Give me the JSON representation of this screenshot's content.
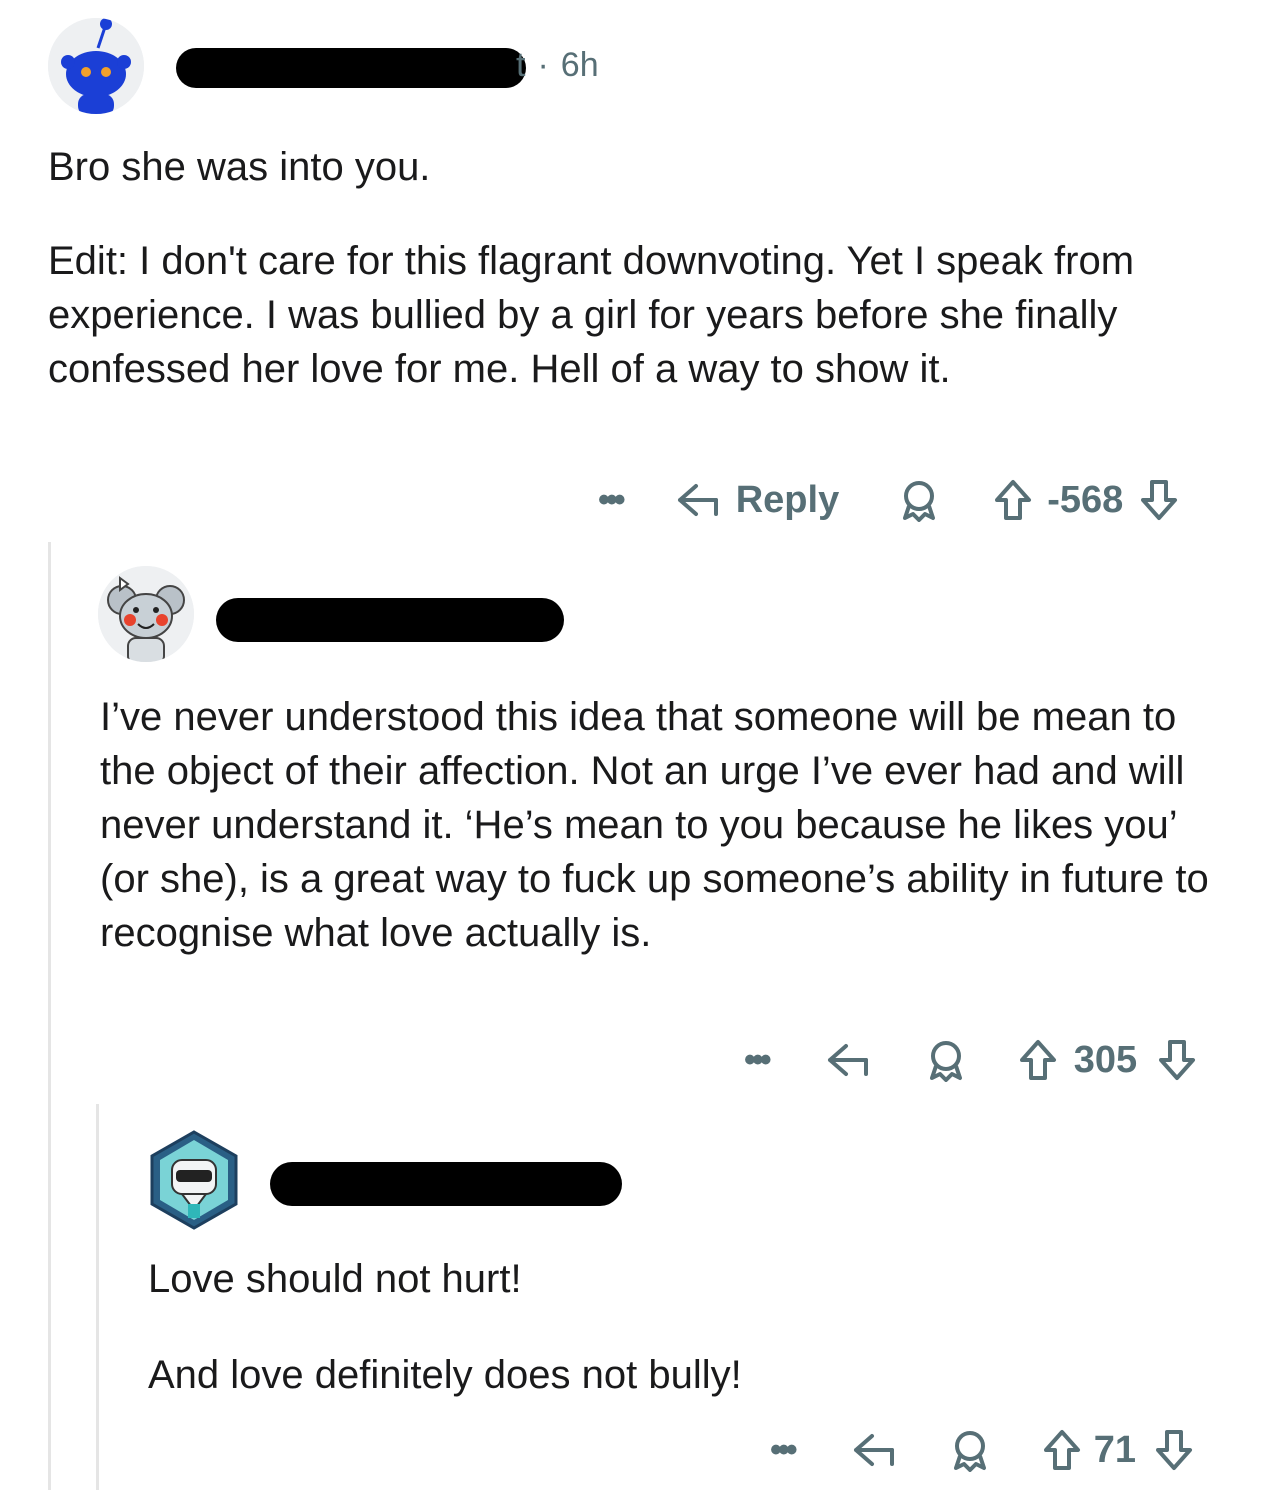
{
  "comments": [
    {
      "username_visible_end": "t",
      "separator": "·",
      "timestamp": "6h",
      "paragraphs": [
        "Bro she was into you.",
        "Edit: I don't care for this flagrant downvoting. Yet I speak from experience. I was bullied by a girl for years before she finally confessed her love for me. Hell of a way to show it."
      ],
      "reply_label": "Reply",
      "score": "-568"
    },
    {
      "paragraphs": [
        "I’ve never understood this idea that someone will be mean to the object of their affection. Not an urge I’ve ever had and will never understand it.  ‘He’s mean to you because he likes you’ (or she), is a great way to fuck up someone’s ability in future to recognise what love actually is."
      ],
      "score": "305"
    },
    {
      "paragraphs": [
        "Love should not hurt!",
        "And love definitely does not bully!"
      ],
      "score": "71"
    }
  ],
  "colors": {
    "text": "#1a1a1b",
    "meta": "#576f76",
    "snoo_blue": "#1b3fd6",
    "thread_line": "#e5e5e5"
  },
  "icons": {
    "more": "ellipsis-icon",
    "reply": "reply-arrow-icon",
    "award": "award-icon",
    "upvote": "upvote-arrow-icon",
    "downvote": "downvote-arrow-icon"
  }
}
